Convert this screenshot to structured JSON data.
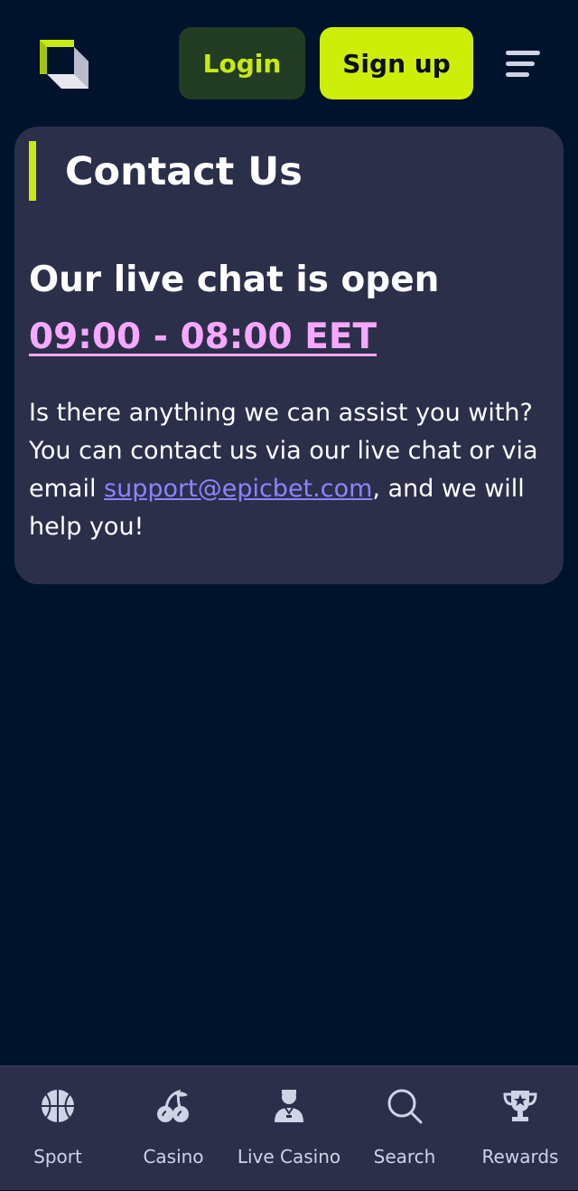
{
  "header": {
    "logo_icon": "epicbet-logo-icon",
    "login_label": "Login",
    "signup_label": "Sign up",
    "menu_icon": "menu-icon"
  },
  "contact": {
    "title": "Contact Us",
    "live_chat_prefix": "Our live chat is open ",
    "live_chat_hours": "09:00 - 08:00 EET",
    "description_prefix": "Is there anything we can assist you with? You can contact us via our live chat or via email ",
    "email": "support@epicbet.com",
    "description_suffix": ", and we will help you!"
  },
  "bottom_nav": {
    "items": [
      {
        "label": "Sport",
        "icon": "basketball-icon"
      },
      {
        "label": "Casino",
        "icon": "cherries-icon"
      },
      {
        "label": "Live Casino",
        "icon": "dealer-icon"
      },
      {
        "label": "Search",
        "icon": "search-icon"
      },
      {
        "label": "Rewards",
        "icon": "trophy-icon"
      }
    ]
  },
  "colors": {
    "background": "#00132d",
    "card": "#2c2f4a",
    "accent": "#cdee08",
    "login_bg": "#233c24",
    "hours_link": "#f6a8ff",
    "email_link": "#8c84ff"
  }
}
